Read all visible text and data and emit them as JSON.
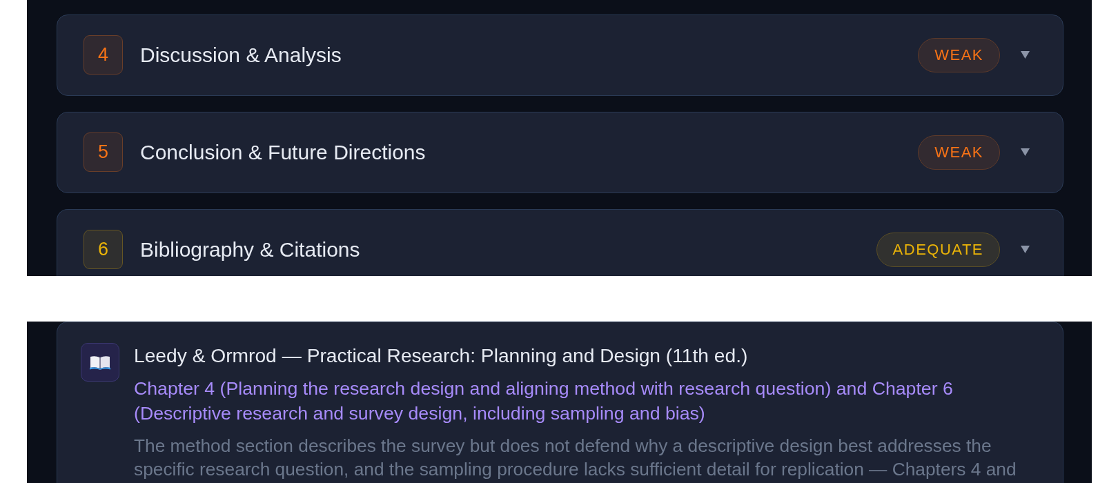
{
  "sections": [
    {
      "number": "4",
      "title": "Discussion & Analysis",
      "rating": "WEAK",
      "color": "#f97316"
    },
    {
      "number": "5",
      "title": "Conclusion & Future Directions",
      "rating": "WEAK",
      "color": "#f97316"
    },
    {
      "number": "6",
      "title": "Bibliography & Citations",
      "rating": "ADEQUATE",
      "color": "#eab308"
    }
  ],
  "resource": {
    "title": "Leedy & Ormrod — Practical Research: Planning and Design (11th ed.)",
    "chapters": "Chapter 4 (Planning the research design and aligning method with research question) and Chapter 6 (Descriptive research and survey design, including sampling and bias)",
    "note": "The method section describes the survey but does not defend why a descriptive design best addresses the specific research question, and the sampling procedure lacks sufficient detail for replication — Chapters 4 and"
  }
}
